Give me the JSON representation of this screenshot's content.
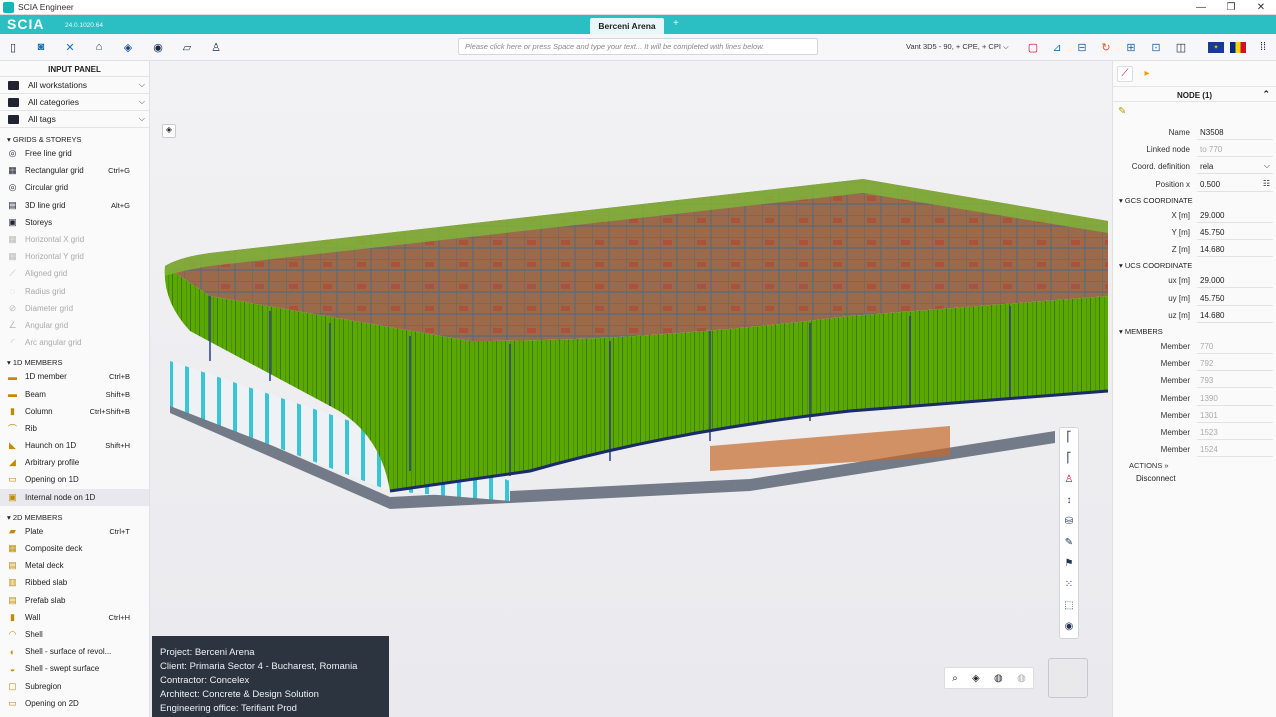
{
  "window": {
    "title": "SCIA Engineer",
    "min": "—",
    "max": "❐",
    "close": "✕"
  },
  "brand": {
    "logo": "SCIA",
    "version": "24.0.1020.64",
    "tab": "Berceni Arena",
    "add_tab": "+"
  },
  "toolbar": {
    "command_placeholder": "Please click here or press Space and type your text... It will be completed with lines below.",
    "view_selection": "Vant 3D5 - 90, + CPE, + CPI"
  },
  "input_panel": {
    "title": "INPUT PANEL",
    "filters": [
      {
        "label": "All workstations"
      },
      {
        "label": "All categories"
      },
      {
        "label": "All tags"
      }
    ],
    "sections": [
      {
        "title": "GRIDS & STOREYS",
        "items": [
          {
            "label": "Free line grid",
            "shortcut": "",
            "icon": "free-line-grid-icon",
            "glyph": "◎",
            "disabled": false
          },
          {
            "label": "Rectangular grid",
            "shortcut": "Ctrl+G",
            "icon": "rectangular-grid-icon",
            "glyph": "▦",
            "disabled": false
          },
          {
            "label": "Circular grid",
            "shortcut": "",
            "icon": "circular-grid-icon",
            "glyph": "◎",
            "disabled": false
          },
          {
            "label": "3D line grid",
            "shortcut": "Alt+G",
            "icon": "3d-line-grid-icon",
            "glyph": "▤",
            "disabled": false
          },
          {
            "label": "Storeys",
            "shortcut": "",
            "icon": "storeys-icon",
            "glyph": "▣",
            "disabled": false
          },
          {
            "label": "Horizontal X grid",
            "shortcut": "",
            "icon": "horizontal-x-grid-icon",
            "glyph": "▦",
            "disabled": true
          },
          {
            "label": "Horizontal Y grid",
            "shortcut": "",
            "icon": "horizontal-y-grid-icon",
            "glyph": "▦",
            "disabled": true
          },
          {
            "label": "Aligned grid",
            "shortcut": "",
            "icon": "aligned-grid-icon",
            "glyph": "⟋",
            "disabled": true
          },
          {
            "label": "Radius grid",
            "shortcut": "",
            "icon": "radius-grid-icon",
            "glyph": "◌",
            "disabled": true
          },
          {
            "label": "Diameter grid",
            "shortcut": "",
            "icon": "diameter-grid-icon",
            "glyph": "⊘",
            "disabled": true
          },
          {
            "label": "Angular grid",
            "shortcut": "",
            "icon": "angular-grid-icon",
            "glyph": "∠",
            "disabled": true
          },
          {
            "label": "Arc angular grid",
            "shortcut": "",
            "icon": "arc-angular-grid-icon",
            "glyph": "◜",
            "disabled": true
          }
        ]
      },
      {
        "title": "1D MEMBERS",
        "items": [
          {
            "label": "1D member",
            "shortcut": "Ctrl+B",
            "icon": "1d-member-icon",
            "glyph": "▬",
            "disabled": false
          },
          {
            "label": "Beam",
            "shortcut": "Shift+B",
            "icon": "beam-icon",
            "glyph": "▬",
            "disabled": false
          },
          {
            "label": "Column",
            "shortcut": "Ctrl+Shift+B",
            "icon": "column-icon",
            "glyph": "▮",
            "disabled": false
          },
          {
            "label": "Rib",
            "shortcut": "",
            "icon": "rib-icon",
            "glyph": "⌒",
            "disabled": false
          },
          {
            "label": "Haunch on 1D",
            "shortcut": "Shift+H",
            "icon": "haunch-icon",
            "glyph": "◣",
            "disabled": false
          },
          {
            "label": "Arbitrary profile",
            "shortcut": "",
            "icon": "arbitrary-profile-icon",
            "glyph": "◢",
            "disabled": false
          },
          {
            "label": "Opening on 1D",
            "shortcut": "",
            "icon": "opening-1d-icon",
            "glyph": "▭",
            "disabled": false
          },
          {
            "label": "Internal node on 1D",
            "shortcut": "",
            "icon": "internal-node-icon",
            "glyph": "▣",
            "disabled": false
          }
        ]
      },
      {
        "title": "2D MEMBERS",
        "items": [
          {
            "label": "Plate",
            "shortcut": "Ctrl+T",
            "icon": "plate-icon",
            "glyph": "▰",
            "disabled": false
          },
          {
            "label": "Composite deck",
            "shortcut": "",
            "icon": "composite-deck-icon",
            "glyph": "▦",
            "disabled": false
          },
          {
            "label": "Metal deck",
            "shortcut": "",
            "icon": "metal-deck-icon",
            "glyph": "▤",
            "disabled": false
          },
          {
            "label": "Ribbed slab",
            "shortcut": "",
            "icon": "ribbed-slab-icon",
            "glyph": "▥",
            "disabled": false
          },
          {
            "label": "Prefab slab",
            "shortcut": "",
            "icon": "prefab-slab-icon",
            "glyph": "▤",
            "disabled": false
          },
          {
            "label": "Wall",
            "shortcut": "Ctrl+H",
            "icon": "wall-icon",
            "glyph": "▮",
            "disabled": false
          },
          {
            "label": "Shell",
            "shortcut": "",
            "icon": "shell-icon",
            "glyph": "◠",
            "disabled": false
          },
          {
            "label": "Shell - surface of revol...",
            "shortcut": "",
            "icon": "shell-revolution-icon",
            "glyph": "◐",
            "disabled": false
          },
          {
            "label": "Shell - swept surface",
            "shortcut": "",
            "icon": "shell-swept-icon",
            "glyph": "◒",
            "disabled": false
          },
          {
            "label": "Subregion",
            "shortcut": "",
            "icon": "subregion-icon",
            "glyph": "▢",
            "disabled": false
          },
          {
            "label": "Opening on 2D",
            "shortcut": "",
            "icon": "opening-2d-icon",
            "glyph": "▭",
            "disabled": false
          }
        ]
      }
    ]
  },
  "project_info": [
    "Project: Berceni Arena",
    "Client: Primaria Sector 4 - Bucharest, Romania",
    "Contractor: Concelex",
    "Architect: Concrete & Design Solution",
    "Engineering office: Terifiant Prod"
  ],
  "properties": {
    "title": "NODE (1)",
    "rows": [
      {
        "label": "Name",
        "value": "N3508",
        "disabled": false
      },
      {
        "label": "Linked node",
        "value": "to 770",
        "disabled": true
      },
      {
        "label": "Coord. definition",
        "value": "rela",
        "disabled": false
      },
      {
        "label": "Position x",
        "value": "0.500",
        "disabled": false
      }
    ],
    "gcs": {
      "title": "GCS COORDINATE",
      "rows": [
        {
          "label": "X [m]",
          "value": "29.000"
        },
        {
          "label": "Y [m]",
          "value": "45.750"
        },
        {
          "label": "Z [m]",
          "value": "14.680"
        }
      ]
    },
    "ucs": {
      "title": "UCS COORDINATE",
      "rows": [
        {
          "label": "ux [m]",
          "value": "29.000"
        },
        {
          "label": "uy [m]",
          "value": "45.750"
        },
        {
          "label": "uz [m]",
          "value": "14.680"
        }
      ]
    },
    "members": {
      "title": "MEMBERS",
      "rows": [
        {
          "label": "Member",
          "value": "770"
        },
        {
          "label": "Member",
          "value": "792"
        },
        {
          "label": "Member",
          "value": "793"
        },
        {
          "label": "Member",
          "value": "1390"
        },
        {
          "label": "Member",
          "value": "1301"
        },
        {
          "label": "Member",
          "value": "1523"
        },
        {
          "label": "Member",
          "value": "1524"
        }
      ]
    },
    "actions": {
      "title": "ACTIONS",
      "disconnect": "Disconnect"
    }
  },
  "viewport": {
    "corner_label": "Λ"
  },
  "colors": {
    "brand": "#2bbfc4",
    "model_green": "#5aa800",
    "info_bg": "#2c3440"
  }
}
